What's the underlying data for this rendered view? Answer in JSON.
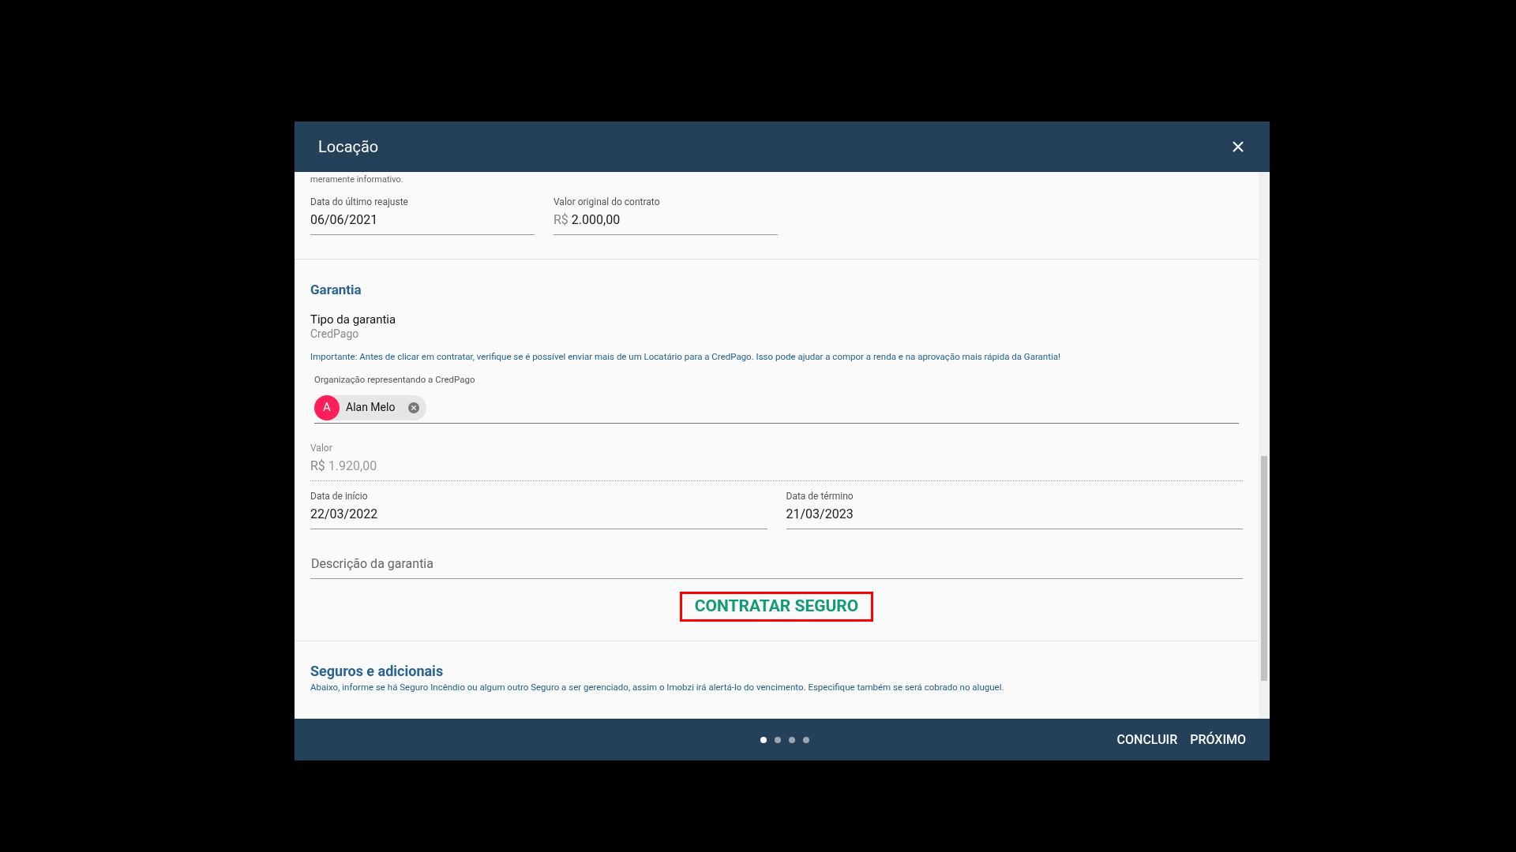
{
  "window": {
    "title": "Locação"
  },
  "intro_tail": "meramente informativo.",
  "contract_fields": [
    {
      "label": "Data do último reajuste",
      "value": "06/06/2021"
    },
    {
      "label": "Valor original do contrato",
      "prefix": "R$",
      "value": "2.000,00"
    }
  ],
  "guarantee": {
    "heading": "Garantia",
    "type_label": "Tipo da garantia",
    "type_value": "CredPago",
    "notice": "Importante: Antes de clicar em contratar, verifique se é possível enviar mais de um Locatário para a CredPago. Isso pode ajudar a compor a renda e na aprovação mais rápida da Garantia!",
    "org_label": "Organização representando a CredPago",
    "chips": [
      {
        "initial": "A",
        "name": "Alan Melo",
        "color": "#ff1f5a"
      }
    ],
    "value_field": {
      "label": "Valor",
      "prefix": "R$",
      "value": "1.920,00",
      "disabled": true
    },
    "dates": [
      {
        "label": "Data de início",
        "value": "22/03/2022"
      },
      {
        "label": "Data de término",
        "value": "21/03/2023"
      }
    ],
    "description": {
      "placeholder": "Descrição da garantia"
    },
    "action": "CONTRATAR SEGURO"
  },
  "insurance": {
    "heading": "Seguros e adicionais",
    "text": "Abaixo, informe se há Seguro Incêndio ou algum outro Seguro a ser gerenciado, assim o Imobzi irá alertá-lo do vencimento. Especifique também se será cobrado no aluguel."
  },
  "steps": [
    {
      "selected": true
    },
    {
      "selected": false
    },
    {
      "selected": false
    },
    {
      "selected": false
    }
  ],
  "buttons": [
    "CONCLUIR",
    "PRÓXIMO"
  ]
}
